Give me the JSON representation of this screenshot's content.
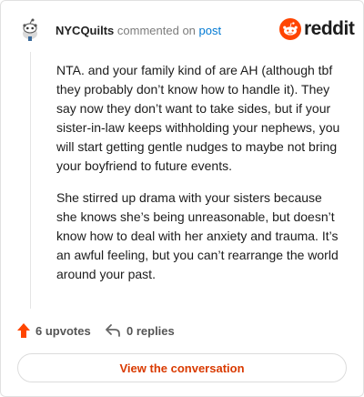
{
  "header": {
    "username": "NYCQuilts",
    "verb": "commented on",
    "link": "post",
    "brand": "reddit",
    "brand_color": "#ff4500",
    "avatar_icon": "snoo-avatar-icon"
  },
  "comment": {
    "paragraphs": [
      "NTA. and your family kind of are AH (although tbf they probably don’t know how to handle it). They say now they don’t want to take sides, but if your sister-in-law keeps withholding your nephews, you will start getting gentle nudges to maybe not bring your boyfriend to future events.",
      "She stirred up drama with your sisters because she knows she’s being unreasonable, but doesn’t know how to deal with her anxiety and trauma. It’s an awful feeling, but you can’t rearrange the world around your past."
    ]
  },
  "actions": {
    "upvotes_label": "6 upvotes",
    "upvote_icon": "upvote-arrow-icon",
    "upvote_color": "#ff4500",
    "replies_label": "0 replies",
    "reply_icon": "reply-arrow-icon"
  },
  "cta": {
    "label": "View the conversation",
    "color": "#d93a00"
  }
}
